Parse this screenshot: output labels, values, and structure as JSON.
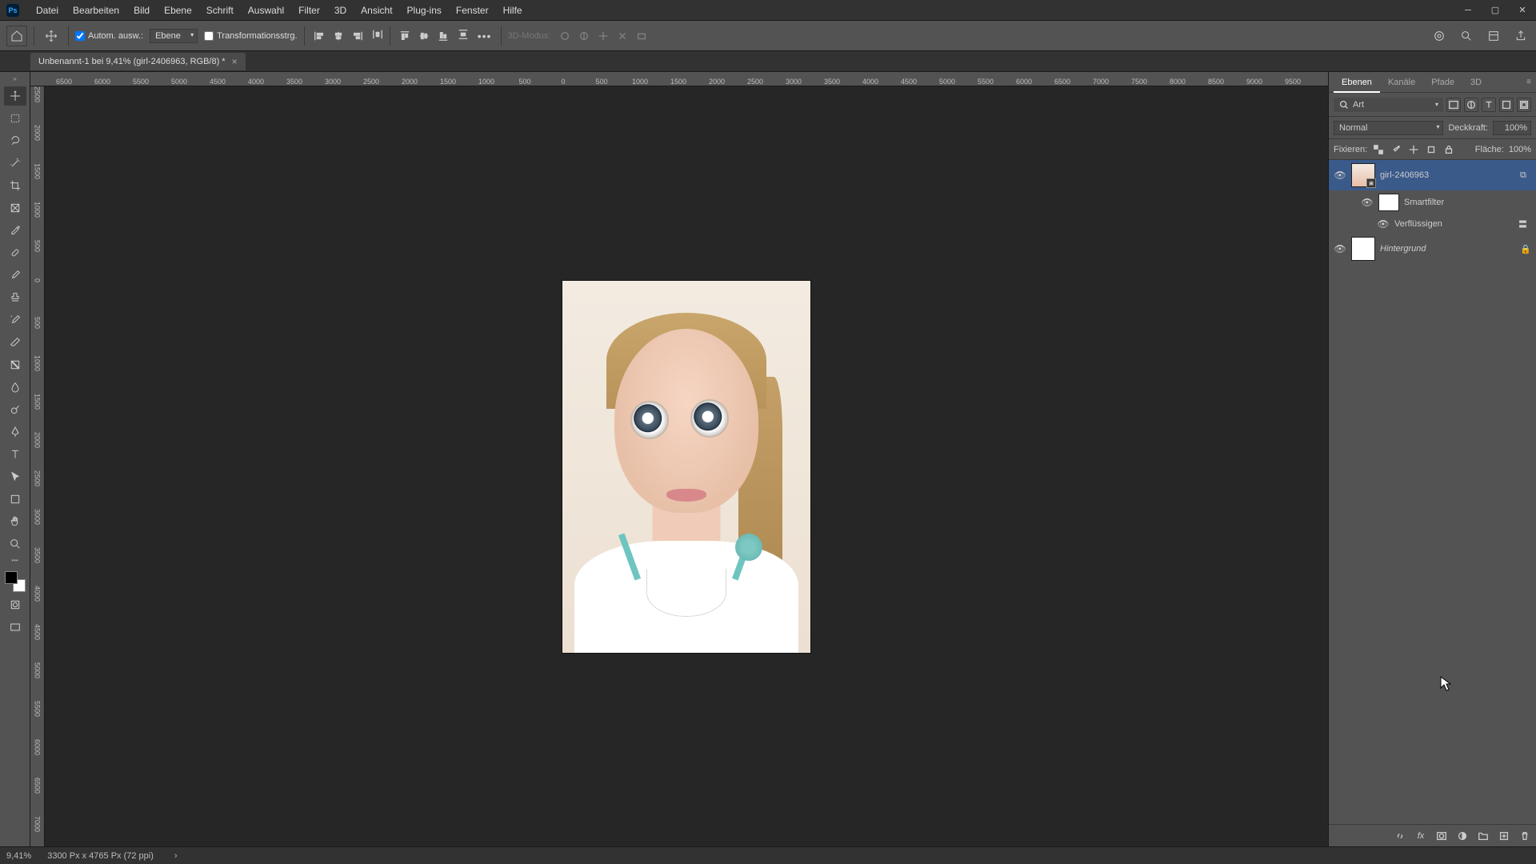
{
  "app": {
    "logo_text": "Ps"
  },
  "menu": {
    "items": [
      "Datei",
      "Bearbeiten",
      "Bild",
      "Ebene",
      "Schrift",
      "Auswahl",
      "Filter",
      "3D",
      "Ansicht",
      "Plug-ins",
      "Fenster",
      "Hilfe"
    ]
  },
  "window_controls": {
    "min": "─",
    "max": "▢",
    "close": "✕"
  },
  "options": {
    "auto_select_label": "Autom. ausw.:",
    "auto_select_target": "Ebene",
    "transform_controls_label": "Transformationsstrg.",
    "more_label": "•••",
    "mode3d_label": "3D-Modus:"
  },
  "document": {
    "tab_title": "Unbenannt-1 bei 9,41% (girl-2406963, RGB/8) *"
  },
  "ruler_h": [
    "6500",
    "6000",
    "5500",
    "5000",
    "4500",
    "4000",
    "3500",
    "3000",
    "2500",
    "2000",
    "1500",
    "1000",
    "500",
    "0",
    "500",
    "1000",
    "1500",
    "2000",
    "2500",
    "3000",
    "3500",
    "4000",
    "4500",
    "5000",
    "5500",
    "6000",
    "6500",
    "7000",
    "7500",
    "8000",
    "8500",
    "9000",
    "9500"
  ],
  "ruler_v": [
    "2500",
    "2000",
    "1500",
    "1000",
    "500",
    "0",
    "500",
    "1000",
    "1500",
    "2000",
    "2500",
    "3000",
    "3500",
    "4000",
    "4500",
    "5000",
    "5500",
    "6000",
    "6500",
    "7000"
  ],
  "panels": {
    "tabs": [
      "Ebenen",
      "Kanäle",
      "Pfade",
      "3D"
    ],
    "filter_search_label": "Art",
    "blend_mode": "Normal",
    "opacity_label": "Deckkraft:",
    "opacity_value": "100%",
    "lock_label": "Fixieren:",
    "fill_label": "Fläche:",
    "fill_value": "100%"
  },
  "layers": [
    {
      "name": "girl-2406963",
      "smart": true,
      "selected": true
    },
    {
      "name": "Smartfilter",
      "sub": true
    },
    {
      "name": "Verflüssigen",
      "sub2": true
    },
    {
      "name": "Hintergrund",
      "locked": true,
      "italic": true
    }
  ],
  "status": {
    "zoom": "9,41%",
    "doc_info": "3300 Px x 4765 Px (72 ppi)"
  }
}
